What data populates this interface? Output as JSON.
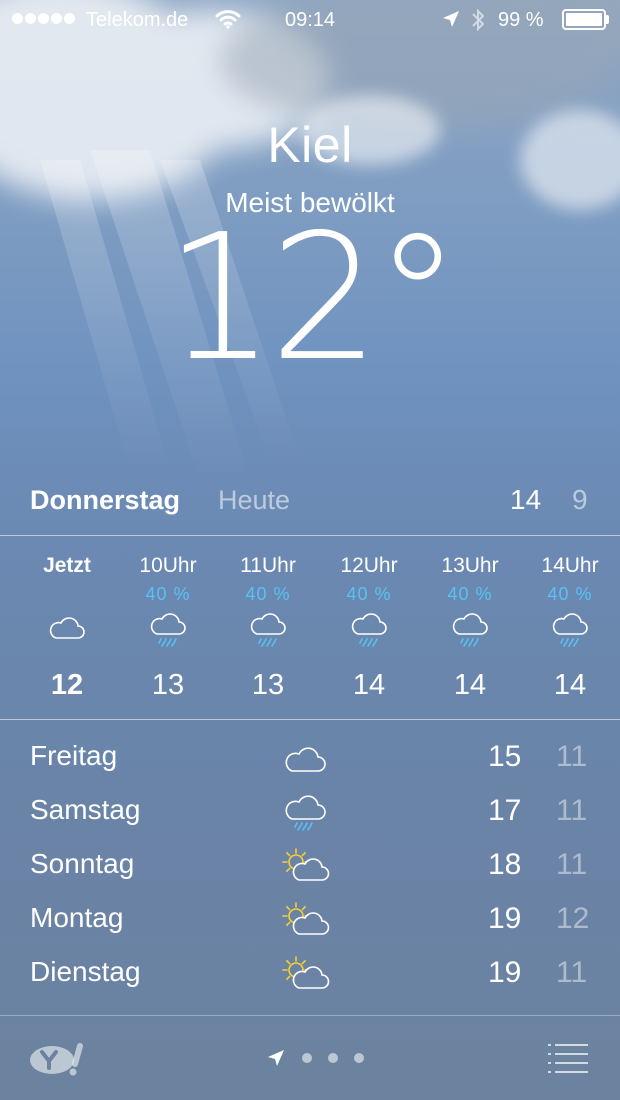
{
  "status_bar": {
    "carrier": "Telekom.de",
    "time": "09:14",
    "battery_percent": "99 %",
    "battery_level": 0.99
  },
  "location": {
    "city": "Kiel",
    "condition": "Meist bewölkt",
    "temperature": "12°"
  },
  "today": {
    "day": "Donnerstag",
    "label": "Heute",
    "high": "14",
    "low": "9"
  },
  "hourly": [
    {
      "label": "Jetzt",
      "precip": "",
      "icon": "cloud-icon",
      "temp": "12"
    },
    {
      "label": "10Uhr",
      "precip": "40 %",
      "icon": "rain-cloud-icon",
      "temp": "13"
    },
    {
      "label": "11Uhr",
      "precip": "40 %",
      "icon": "rain-cloud-icon",
      "temp": "13"
    },
    {
      "label": "12Uhr",
      "precip": "40 %",
      "icon": "rain-cloud-icon",
      "temp": "14"
    },
    {
      "label": "13Uhr",
      "precip": "40 %",
      "icon": "rain-cloud-icon",
      "temp": "14"
    },
    {
      "label": "14Uhr",
      "precip": "40 %",
      "icon": "rain-cloud-icon",
      "temp": "14"
    }
  ],
  "daily": [
    {
      "day": "Freitag",
      "icon": "cloud-icon",
      "high": "15",
      "low": "11"
    },
    {
      "day": "Samstag",
      "icon": "rain-cloud-icon",
      "high": "17",
      "low": "11"
    },
    {
      "day": "Sonntag",
      "icon": "sun-cloud-icon",
      "high": "18",
      "low": "11"
    },
    {
      "day": "Montag",
      "icon": "sun-cloud-icon",
      "high": "19",
      "low": "12"
    },
    {
      "day": "Dienstag",
      "icon": "sun-cloud-icon",
      "high": "19",
      "low": "11"
    }
  ],
  "toolbar": {
    "provider_icon": "yahoo-logo",
    "pages": 3,
    "current_page": "location-arrow-icon",
    "list_icon": "list-icon"
  },
  "colors": {
    "precip_blue": "#58c2f5",
    "sun_yellow": "#f5d033"
  }
}
